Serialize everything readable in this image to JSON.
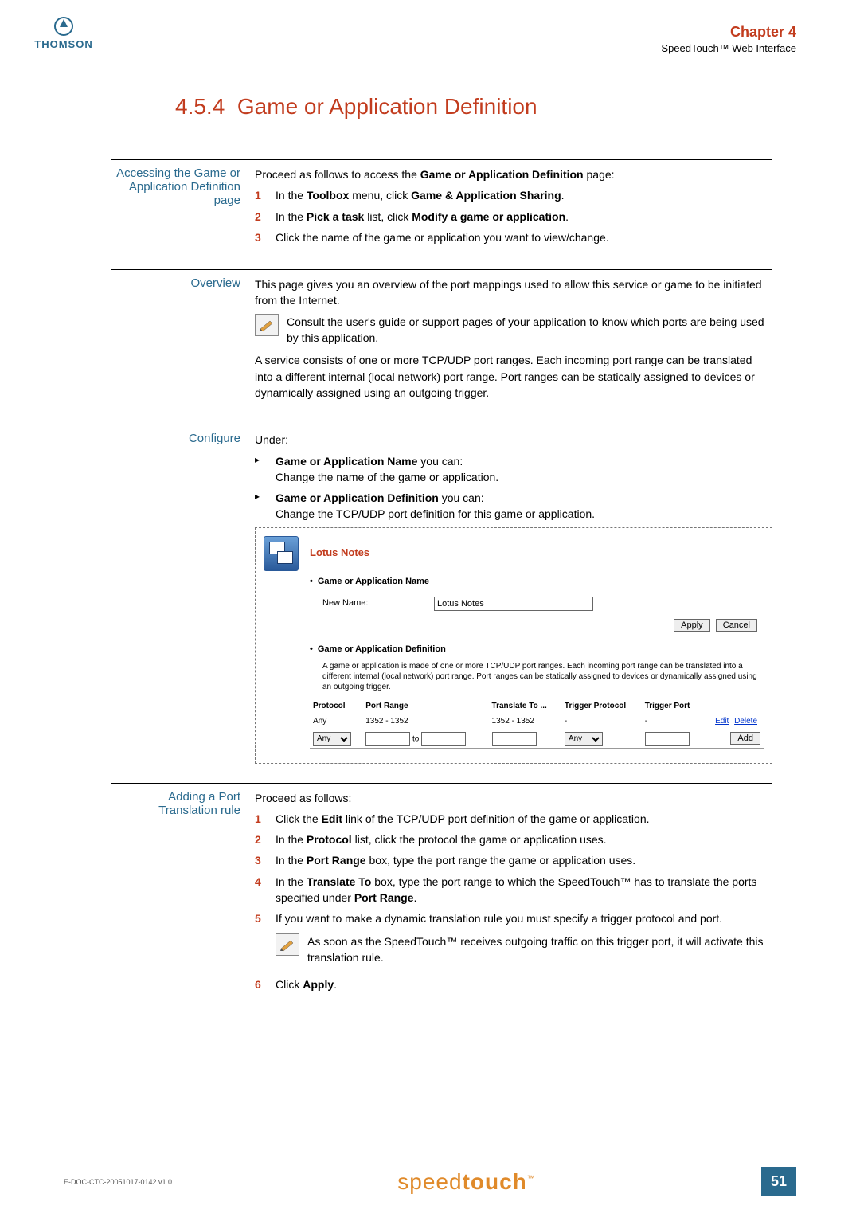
{
  "header": {
    "brand": "THOMSON",
    "chapter": "Chapter 4",
    "subhead": "SpeedTouch™ Web Interface"
  },
  "title": {
    "num": "4.5.4",
    "text": "Game or Application Definition"
  },
  "section_accessing": {
    "label": "Accessing the Game or Application Definition page",
    "intro": "Proceed as follows to access the ",
    "intro_bold": "Game or Application Definition",
    "intro_tail": " page:",
    "steps": [
      {
        "pre": "In the ",
        "b1": "Toolbox",
        "mid": " menu, click ",
        "b2": "Game & Application Sharing",
        "post": "."
      },
      {
        "pre": "In the ",
        "b1": "Pick a task",
        "mid": " list, click ",
        "b2": "Modify a game or application",
        "post": "."
      },
      {
        "pre": "Click the name of the game or application you want to view/change.",
        "b1": "",
        "mid": "",
        "b2": "",
        "post": ""
      }
    ]
  },
  "section_overview": {
    "label": "Overview",
    "p1": "This page gives you an overview of the port mappings used to allow this service or game to be initiated from the Internet.",
    "note": "Consult the user's guide or support pages of your application to know which ports are being used by this application.",
    "p2": "A service consists of one or more TCP/UDP port ranges. Each incoming port range can be translated into a different internal (local network) port range. Port ranges can be statically assigned to devices or dynamically assigned using an outgoing trigger."
  },
  "section_configure": {
    "label": "Configure",
    "under": "Under:",
    "items": [
      {
        "b": "Game or Application Name",
        "tail": " you can:",
        "desc": "Change the name of the game or application."
      },
      {
        "b": "Game or Application Definition",
        "tail": " you can:",
        "desc": "Change the TCP/UDP port definition for this game or application."
      }
    ]
  },
  "ui": {
    "title": "Lotus Notes",
    "sec1": "Game or Application Name",
    "newname_label": "New Name:",
    "newname_value": "Lotus Notes",
    "apply": "Apply",
    "cancel": "Cancel",
    "sec2": "Game or Application Definition",
    "desc": "A game or application is made of one or more TCP/UDP port ranges. Each incoming port range can be translated into a different internal (local network) port range. Port ranges can be statically assigned to devices or dynamically assigned using an outgoing trigger.",
    "th": [
      "Protocol",
      "Port Range",
      "Translate To ...",
      "Trigger Protocol",
      "Trigger Port",
      ""
    ],
    "row1": [
      "Any",
      "1352 - 1352",
      "1352 - 1352",
      "-",
      "-"
    ],
    "edit": "Edit",
    "delete": "Delete",
    "add": "Add",
    "any": "Any",
    "to": "to"
  },
  "section_adding": {
    "label": "Adding a Port Translation rule",
    "intro": "Proceed as follows:",
    "steps": [
      {
        "txt_pre": "Click the ",
        "b": "Edit",
        "txt_post": " link of the TCP/UDP port definition of the game or application."
      },
      {
        "txt_pre": "In the ",
        "b": "Protocol",
        "txt_post": " list, click the protocol the game or application uses."
      },
      {
        "txt_pre": "In the ",
        "b": "Port Range",
        "txt_post": " box, type the port range the game or application uses."
      },
      {
        "txt_pre": "In the ",
        "b": "Translate To",
        "txt_post": " box, type the port range to which the SpeedTouch™ has to translate the ports specified under ",
        "b2": "Port Range",
        "tail": "."
      },
      {
        "txt_pre": "If you want to make a dynamic translation rule you must specify a trigger protocol and port.",
        "b": "",
        "txt_post": ""
      },
      {
        "txt_pre": "Click ",
        "b": "Apply",
        "txt_post": "."
      }
    ],
    "note": "As soon as the SpeedTouch™ receives outgoing traffic on this trigger port, it will activate this translation rule."
  },
  "footer": {
    "docref": "E-DOC-CTC-20051017-0142 v1.0",
    "brand_a": "speed",
    "brand_b": "touch",
    "tm": "™",
    "page": "51"
  }
}
